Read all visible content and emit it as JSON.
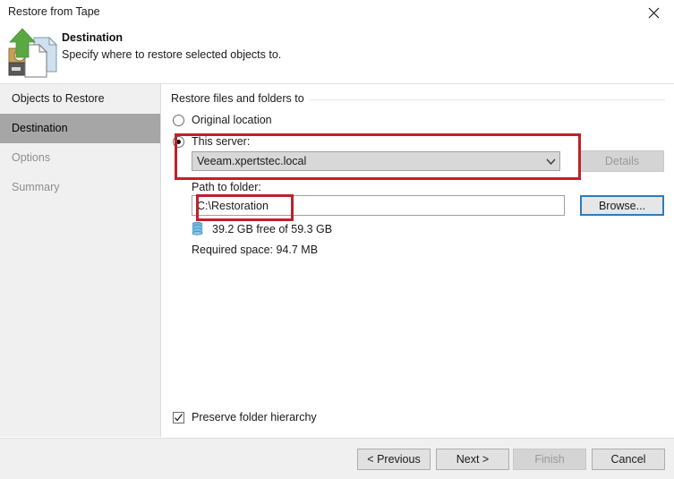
{
  "window": {
    "title": "Restore from Tape",
    "close_icon": "close-icon"
  },
  "header": {
    "icon": "restore-from-tape-icon",
    "title": "Destination",
    "subtitle": "Specify where to restore selected objects to."
  },
  "sidebar": {
    "items": [
      {
        "label": "Objects to Restore",
        "state": "normal"
      },
      {
        "label": "Destination",
        "state": "selected"
      },
      {
        "label": "Options",
        "state": "disabled"
      },
      {
        "label": "Summary",
        "state": "disabled"
      }
    ]
  },
  "main": {
    "group_label": "Restore files and folders to",
    "radios": [
      {
        "label": "Original location",
        "checked": false
      },
      {
        "label": "This server:",
        "checked": true
      }
    ],
    "server_combo": {
      "value": "Veeam.xpertstec.local",
      "arrow_icon": "chevron-down-icon"
    },
    "details_button": {
      "label": "Details",
      "enabled": false
    },
    "path_label": "Path to folder:",
    "path_input": {
      "value": "C:\\Restoration",
      "placeholder": ""
    },
    "browse_button": {
      "label": "Browse...",
      "focused": true
    },
    "disk_info": {
      "icon": "disk-stack-icon",
      "text": "39.2 GB free of 59.3 GB"
    },
    "required_space": "Required space:  94.7 MB",
    "preserve_hierarchy": {
      "label": "Preserve folder hierarchy",
      "checked": true
    }
  },
  "footer": {
    "buttons": [
      {
        "label": "< Previous",
        "enabled": true
      },
      {
        "label": "Next >",
        "enabled": true
      },
      {
        "label": "Finish",
        "enabled": false
      },
      {
        "label": "Cancel",
        "enabled": true
      }
    ]
  },
  "annotations": {
    "red_color": "#c0202a",
    "blue_focus_color": "#2b7cbf",
    "boxes": [
      {
        "name": "this-server-highlight"
      },
      {
        "name": "path-to-folder-highlight"
      }
    ]
  }
}
